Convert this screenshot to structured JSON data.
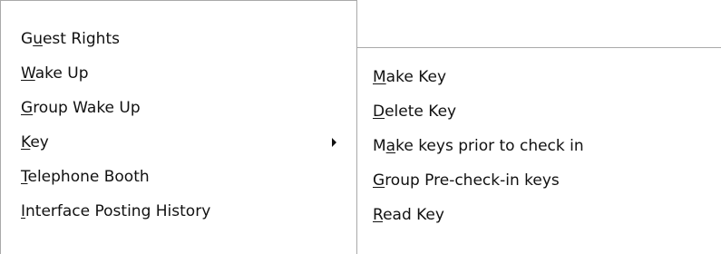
{
  "main_menu": {
    "items": [
      {
        "pre": "G",
        "acc": "u",
        "post": "est Rights"
      },
      {
        "pre": "",
        "acc": "W",
        "post": "ake Up"
      },
      {
        "pre": "",
        "acc": "G",
        "post": "roup Wake Up"
      },
      {
        "pre": "",
        "acc": "K",
        "post": "ey",
        "submenu_icon": "chevron-right-icon"
      },
      {
        "pre": "",
        "acc": "T",
        "post": "elephone Booth"
      },
      {
        "pre": "",
        "acc": "I",
        "post": "nterface Posting History"
      }
    ]
  },
  "key_submenu": {
    "items": [
      {
        "pre": "",
        "acc": "M",
        "post": "ake Key"
      },
      {
        "pre": "",
        "acc": "D",
        "post": "elete Key"
      },
      {
        "pre": "M",
        "acc": "a",
        "post": "ke keys prior to check in"
      },
      {
        "pre": "",
        "acc": "G",
        "post": "roup Pre-check-in keys"
      },
      {
        "pre": "",
        "acc": "R",
        "post": "ead Key"
      }
    ]
  }
}
